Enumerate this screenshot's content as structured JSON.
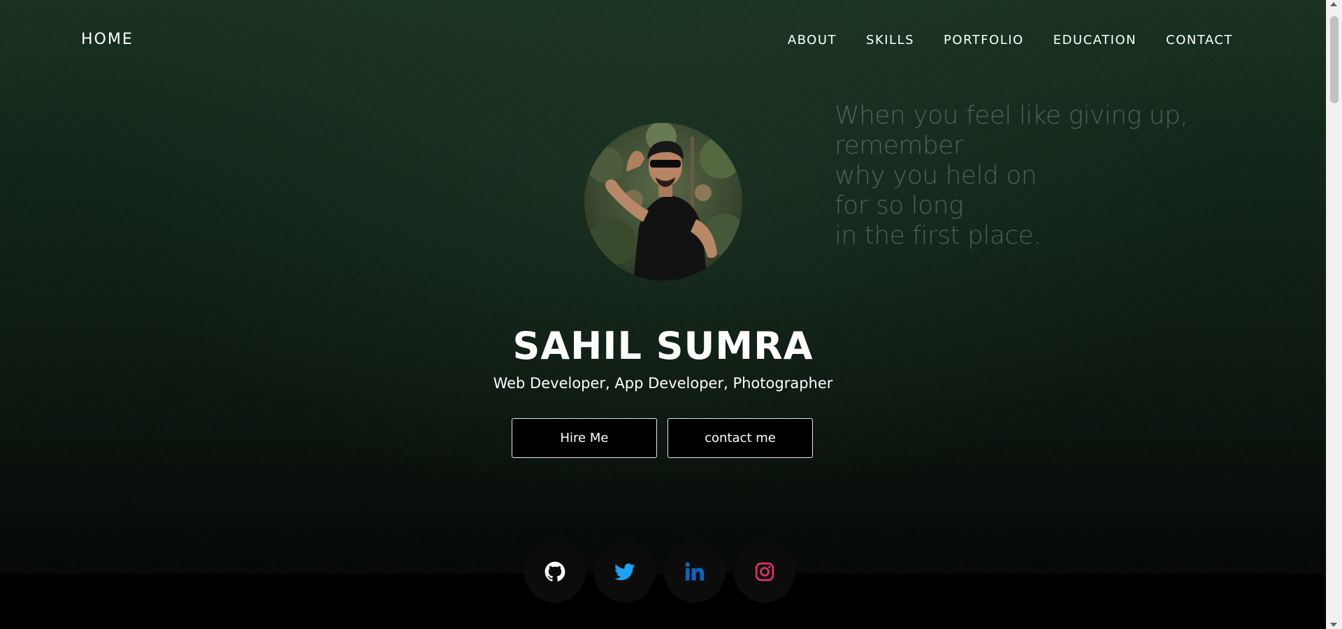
{
  "nav": {
    "home": "HOME",
    "links": [
      "ABOUT",
      "SKILLS",
      "PORTFOLIO",
      "EDUCATION",
      "CONTACT"
    ]
  },
  "quote": {
    "lines": [
      "When you feel like giving up,",
      "remember",
      "why you held on",
      "for so long",
      "in the first place."
    ]
  },
  "profile": {
    "name": "SAHIL SUMRA",
    "tagline": "Web Developer, App Developer, Photographer"
  },
  "buttons": {
    "hire": "Hire Me",
    "contact": "contact me"
  },
  "social": [
    {
      "icon": "github-icon",
      "color": "#ffffff"
    },
    {
      "icon": "twitter-icon",
      "color": "#1da1f2"
    },
    {
      "icon": "linkedin-icon",
      "color": "#0a66c2"
    },
    {
      "icon": "instagram-icon",
      "color": "#e1306c"
    }
  ],
  "colors": {
    "background_top": "#1a3220",
    "background_bottom": "#060906",
    "footer": "#000000",
    "text": "#ffffff"
  }
}
